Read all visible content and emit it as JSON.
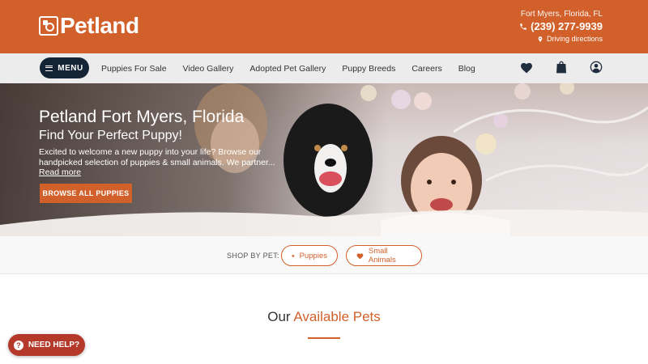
{
  "header": {
    "logo_text": "Petland",
    "city": "Fort Myers, Florida, FL",
    "phone": "(239) 277-9939",
    "directions": "Driving directions"
  },
  "nav": {
    "menu_label": "MENU",
    "links": [
      "Puppies For Sale",
      "Video Gallery",
      "Adopted Pet Gallery",
      "Puppy Breeds",
      "Careers",
      "Blog"
    ]
  },
  "hero": {
    "title": "Petland Fort Myers, Florida",
    "subtitle": "Find Your Perfect Puppy!",
    "description": "Excited to welcome a new puppy into your life? Browse our handpicked selection of puppies & small animals. We partner...",
    "read_more": "Read more",
    "button": "BROWSE ALL PUPPIES"
  },
  "shop": {
    "label": "SHOP BY PET:",
    "puppies": "Puppies",
    "small_animals": "Small Animals"
  },
  "section": {
    "title_plain": "Our",
    "title_accent": "Available Pets"
  },
  "help": {
    "label": "NEED HELP?"
  },
  "colors": {
    "brand": "#d2602a",
    "navy": "#142336",
    "help": "#b5392a"
  }
}
